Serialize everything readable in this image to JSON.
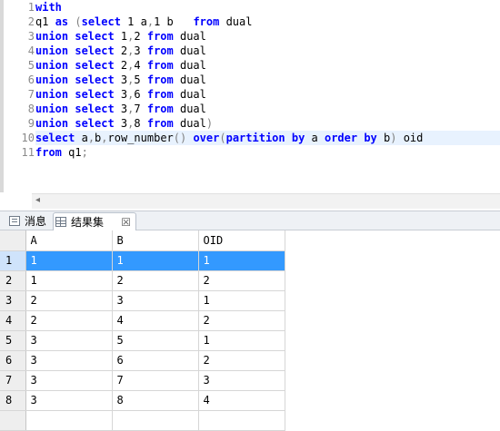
{
  "editor": {
    "line_numbers": [
      "1",
      "2",
      "3",
      "4",
      "5",
      "6",
      "7",
      "8",
      "9",
      "10",
      "11"
    ],
    "lines": [
      [
        [
          "kw",
          "with"
        ]
      ],
      [
        [
          "id",
          "q1 "
        ],
        [
          "kw",
          "as"
        ],
        [
          "op",
          " ("
        ],
        [
          "kw",
          "select"
        ],
        [
          "id",
          " 1 a"
        ],
        [
          "op",
          ","
        ],
        [
          "id",
          "1 b   "
        ],
        [
          "kw",
          "from"
        ],
        [
          "id",
          " dual"
        ]
      ],
      [
        [
          "kw",
          "union select"
        ],
        [
          "id",
          " 1"
        ],
        [
          "op",
          ","
        ],
        [
          "id",
          "2 "
        ],
        [
          "kw",
          "from"
        ],
        [
          "id",
          " dual"
        ]
      ],
      [
        [
          "kw",
          "union select"
        ],
        [
          "id",
          " 2"
        ],
        [
          "op",
          ","
        ],
        [
          "id",
          "3 "
        ],
        [
          "kw",
          "from"
        ],
        [
          "id",
          " dual"
        ]
      ],
      [
        [
          "kw",
          "union select"
        ],
        [
          "id",
          " 2"
        ],
        [
          "op",
          ","
        ],
        [
          "id",
          "4 "
        ],
        [
          "kw",
          "from"
        ],
        [
          "id",
          " dual"
        ]
      ],
      [
        [
          "kw",
          "union select"
        ],
        [
          "id",
          " 3"
        ],
        [
          "op",
          ","
        ],
        [
          "id",
          "5 "
        ],
        [
          "kw",
          "from"
        ],
        [
          "id",
          " dual"
        ]
      ],
      [
        [
          "kw",
          "union select"
        ],
        [
          "id",
          " 3"
        ],
        [
          "op",
          ","
        ],
        [
          "id",
          "6 "
        ],
        [
          "kw",
          "from"
        ],
        [
          "id",
          " dual"
        ]
      ],
      [
        [
          "kw",
          "union select"
        ],
        [
          "id",
          " 3"
        ],
        [
          "op",
          ","
        ],
        [
          "id",
          "7 "
        ],
        [
          "kw",
          "from"
        ],
        [
          "id",
          " dual"
        ]
      ],
      [
        [
          "kw",
          "union select"
        ],
        [
          "id",
          " 3"
        ],
        [
          "op",
          ","
        ],
        [
          "id",
          "8 "
        ],
        [
          "kw",
          "from"
        ],
        [
          "id",
          " dual"
        ],
        [
          "op",
          ")"
        ]
      ],
      [
        [
          "kw",
          "select"
        ],
        [
          "id",
          " a"
        ],
        [
          "op",
          ","
        ],
        [
          "id",
          "b"
        ],
        [
          "op",
          ","
        ],
        [
          "id",
          "row_number"
        ],
        [
          "op",
          "() "
        ],
        [
          "kw",
          "over"
        ],
        [
          "op",
          "("
        ],
        [
          "kw",
          "partition by"
        ],
        [
          "id",
          " a "
        ],
        [
          "kw",
          "order by"
        ],
        [
          "id",
          " b"
        ],
        [
          "op",
          ") "
        ],
        [
          "id",
          "oid"
        ]
      ],
      [
        [
          "kw",
          "from"
        ],
        [
          "id",
          " q1"
        ],
        [
          "op",
          ";"
        ]
      ]
    ],
    "current_line": 10
  },
  "tabs": {
    "messages": "消息",
    "results": "结果集",
    "close": "☒"
  },
  "grid": {
    "columns": [
      "A",
      "B",
      "OID"
    ],
    "rows": [
      [
        "1",
        "1",
        "1",
        "1"
      ],
      [
        "2",
        "1",
        "2",
        "2"
      ],
      [
        "3",
        "2",
        "3",
        "1"
      ],
      [
        "4",
        "2",
        "4",
        "2"
      ],
      [
        "5",
        "3",
        "5",
        "1"
      ],
      [
        "6",
        "3",
        "6",
        "2"
      ],
      [
        "7",
        "3",
        "7",
        "3"
      ],
      [
        "8",
        "3",
        "8",
        "4"
      ]
    ],
    "selected_row": 0
  },
  "colors": {
    "keyword": "#0000ff",
    "selection": "#3399ff",
    "current_line": "#e8f2fe"
  }
}
